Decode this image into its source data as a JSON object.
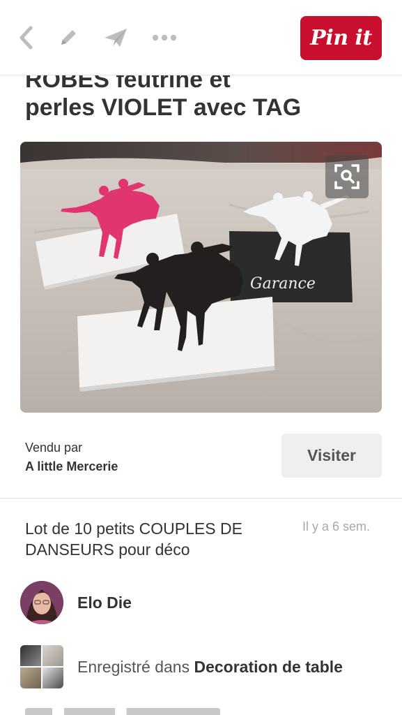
{
  "toolbar": {
    "pin_label": "Pin it",
    "colors": {
      "accent": "#c8102e",
      "icon": "#bdbdbd"
    }
  },
  "pin": {
    "title_line1": "ROBES feutrine et",
    "title_line2": "perles VIOLET avec TAG",
    "image_caption": "Garance",
    "seller_label": "Vendu par",
    "seller_name": "A little Mercerie",
    "visit_label": "Visiter",
    "description": "Lot de 10 petits COUPLES DE DANSEURS pour déco",
    "time_ago": "Il y a 6 sem.",
    "pinner_name": "Elo Die",
    "board_prefix": "Enregistré dans ",
    "board_name": "Decoration de table"
  }
}
